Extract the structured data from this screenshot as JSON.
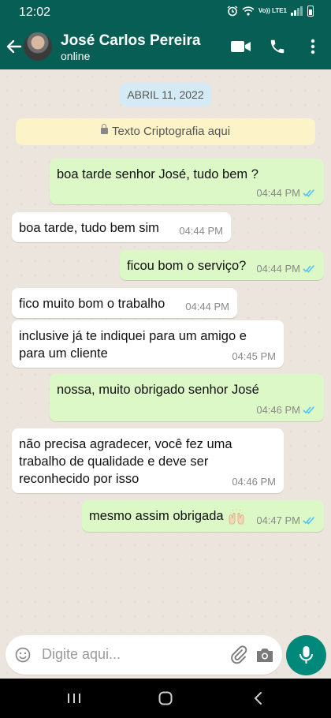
{
  "status_bar": {
    "time": "12:02",
    "network": "Vo)) LTE1"
  },
  "header": {
    "contact_name": "José Carlos Pereira",
    "contact_status": "online"
  },
  "chat": {
    "date_label": "ABRIL 11, 2022",
    "encryption_notice": "Texto Criptografia aqui",
    "messages": [
      {
        "direction": "out",
        "text": "boa tarde senhor José, tudo bem ?",
        "time": "04:44 PM",
        "read": true
      },
      {
        "direction": "in",
        "text": "boa tarde, tudo bem sim",
        "time": "04:44 PM"
      },
      {
        "direction": "out",
        "text": "ficou bom o serviço?",
        "time": "04:44 PM",
        "read": true
      },
      {
        "direction": "in",
        "text": "fico muito bom o trabalho",
        "time": "04:44 PM"
      },
      {
        "direction": "in",
        "text": "inclusive já te indiquei para um amigo e para um cliente",
        "time": "04:45 PM"
      },
      {
        "direction": "out",
        "text": "nossa, muito obrigado senhor José",
        "time": "04:46 PM",
        "read": true
      },
      {
        "direction": "in",
        "text": "não precisa agradecer, você fez uma trabalho de qualidade e deve ser reconhecido por isso",
        "time": "04:46 PM"
      },
      {
        "direction": "out",
        "text": "mesmo assim obrigada",
        "emoji": "raising-hands",
        "time": "04:47 PM",
        "read": true
      }
    ]
  },
  "composer": {
    "placeholder": "Digite aqui..."
  },
  "colors": {
    "header": "#075e54",
    "outgoing_bubble": "#dcf8c6",
    "incoming_bubble": "#ffffff",
    "mic_button": "#00897b",
    "read_ticks": "#4fc3f7"
  }
}
